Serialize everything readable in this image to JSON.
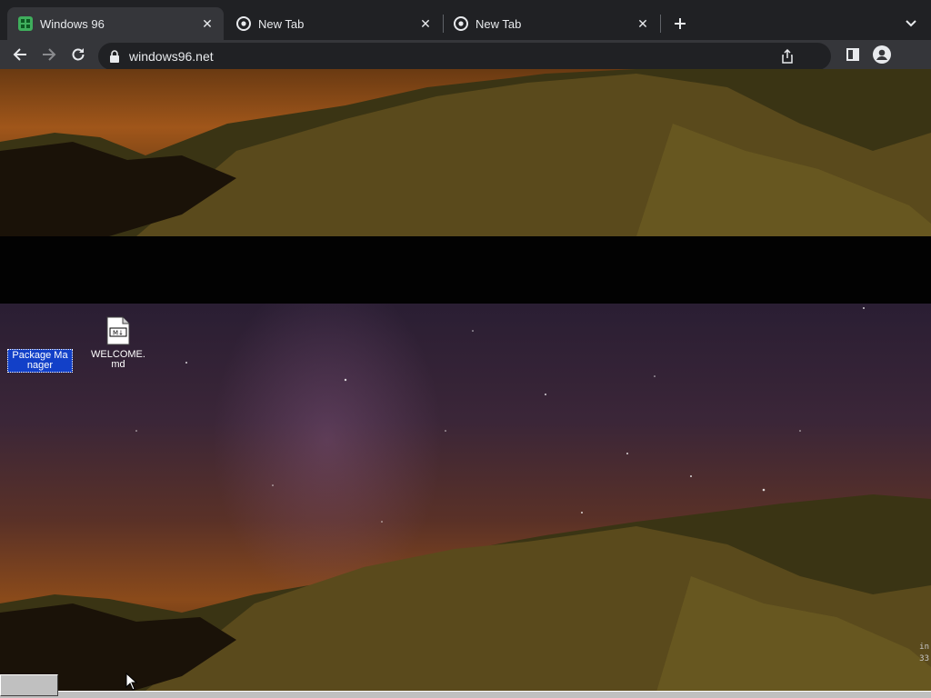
{
  "browser": {
    "tabs": [
      {
        "title": "Windows 96",
        "active": true
      },
      {
        "title": "New Tab",
        "active": false
      },
      {
        "title": "New Tab",
        "active": false
      }
    ],
    "url": "windows96.net",
    "icons": {
      "back": "arrow-left-icon",
      "forward": "arrow-right-icon",
      "reload": "reload-icon",
      "lock": "lock-icon",
      "share": "share-icon",
      "sidepanel": "side-panel-icon",
      "profile": "profile-icon",
      "newtab": "plus-icon",
      "tabsearch": "chevron-down-icon"
    },
    "colors": {
      "tabstrip": "#202124",
      "toolbar": "#35363a",
      "text": "#e8eaed"
    }
  },
  "desktop": {
    "icons": [
      {
        "label": "Package Manager",
        "selected": true
      },
      {
        "label": "WELCOME.md",
        "selected": false,
        "badge": "M↓"
      }
    ],
    "corner_text": [
      "in",
      "33"
    ],
    "selection_color": "#1240c8"
  }
}
